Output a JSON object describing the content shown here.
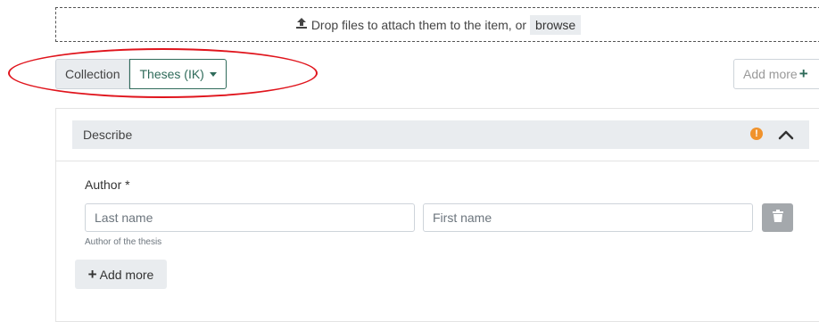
{
  "dropzone": {
    "text": "Drop files to attach them to the item, or",
    "browse_label": "browse",
    "icon": "upload-icon"
  },
  "collection": {
    "label": "Collection",
    "selected": "Theses (IK)"
  },
  "top_actions": {
    "add_more_label": "Add more",
    "plus": "+"
  },
  "section": {
    "title": "Describe",
    "warning_symbol": "!",
    "warning_color": "#f0922b",
    "collapse_icon": "chevron-up-icon"
  },
  "author": {
    "label": "Author *",
    "last_name_placeholder": "Last name",
    "first_name_placeholder": "First name",
    "help_text": "Author of the thesis",
    "add_more_label": "Add more",
    "plus": "+"
  },
  "colors": {
    "accent": "#2f6b5a",
    "highlight_ring": "#e0141c",
    "neutral_bg": "#e9ecef"
  }
}
